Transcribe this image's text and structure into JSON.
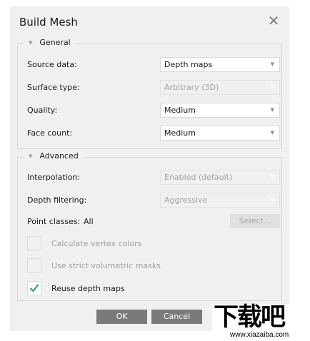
{
  "dialog": {
    "title": "Build Mesh"
  },
  "general": {
    "legend": "General",
    "rows": [
      {
        "label": "Source data:",
        "value": "Depth maps",
        "enabled": true
      },
      {
        "label": "Surface type:",
        "value": "Arbitrary (3D)",
        "enabled": false
      },
      {
        "label": "Quality:",
        "value": "Medium",
        "enabled": true
      },
      {
        "label": "Face count:",
        "value": "Medium",
        "enabled": true
      }
    ]
  },
  "advanced": {
    "legend": "Advanced",
    "rows": [
      {
        "label": "Interpolation:",
        "value": "Enabled (default)",
        "enabled": false
      },
      {
        "label": "Depth filtering:",
        "value": "Aggressive",
        "enabled": false
      }
    ],
    "point_classes": {
      "label": "Point classes:",
      "value": "All",
      "button": "Select..."
    },
    "checkboxes": [
      {
        "label": "Calculate vertex colors",
        "checked": false,
        "enabled": false
      },
      {
        "label": "Use strict volumetric masks",
        "checked": false,
        "enabled": false
      },
      {
        "label": "Reuse depth maps",
        "checked": true,
        "enabled": true
      }
    ]
  },
  "footer": {
    "ok": "OK",
    "cancel": "Cancel"
  },
  "watermark": {
    "chars": "下载吧",
    "url": "www.xiazaiba.com"
  },
  "colors": {
    "check_green": "#22b14c",
    "button_gray": "#7a7a7a",
    "dialog_bg": "#f0f0f0"
  },
  "icons": {
    "close": "close-icon",
    "collapse": "collapse-triangle-icon",
    "dropdown": "chevron-down-icon",
    "check": "checkmark-icon"
  }
}
